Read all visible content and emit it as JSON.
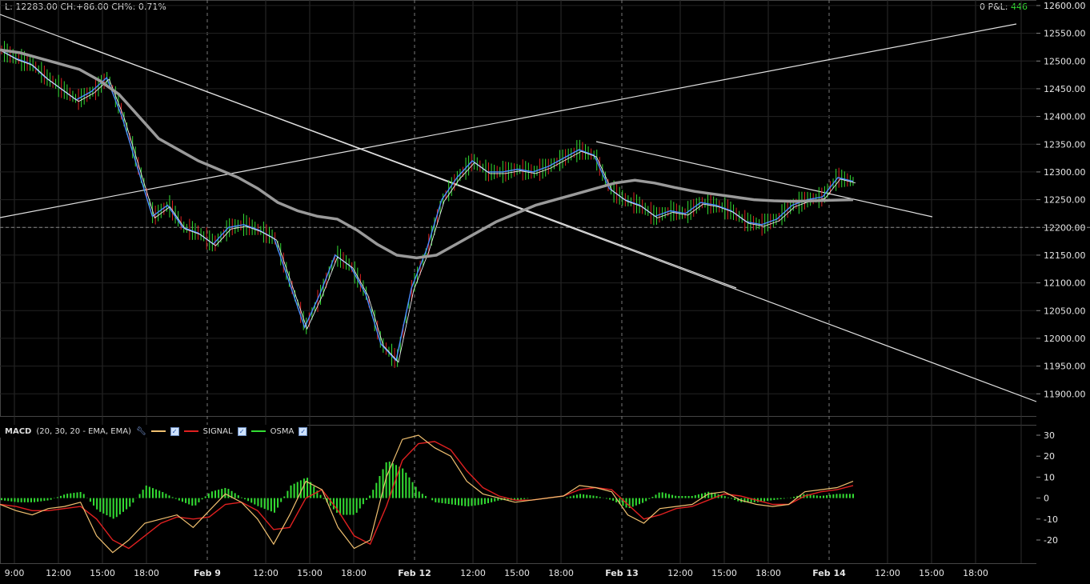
{
  "header": {
    "last_label": "L:",
    "last": "12283.00",
    "change_label": "CH:",
    "change": "+86.00",
    "change_pct_label": "CH%:",
    "change_pct": "0.71%",
    "pnl_value": "0",
    "pnl_label": "P&L:",
    "pnl_amount": "446"
  },
  "price_axis": {
    "ticks": [
      "12600.00",
      "12550.00",
      "12500.00",
      "12450.00",
      "12400.00",
      "12350.00",
      "12300.00",
      "12250.00",
      "12200.00",
      "12150.00",
      "12100.00",
      "12050.00",
      "12000.00",
      "11950.00",
      "11900.00"
    ]
  },
  "macd_legend": {
    "name": "MACD",
    "params": "(20, 30, 20 - EMA, EMA)",
    "signal_label": "SIGNAL",
    "osma_label": "OSMA",
    "colors": {
      "macd": "#f0c070",
      "signal": "#e02020",
      "osma": "#33dd33"
    }
  },
  "macd_axis": {
    "ticks": [
      "30",
      "20",
      "10",
      "0",
      "-10",
      "-20"
    ]
  },
  "time_axis": {
    "ticks": [
      "9:00",
      "12:00",
      "15:00",
      "18:00",
      "Feb 9",
      "12:00",
      "15:00",
      "18:00",
      "Feb 12",
      "12:00",
      "15:00",
      "18:00",
      "Feb 13",
      "12:00",
      "15:00",
      "18:00",
      "Feb 14",
      "12:00",
      "15:00",
      "18:00"
    ]
  },
  "chart_data": [
    {
      "type": "line",
      "title": "",
      "ylim": [
        11860,
        12610
      ],
      "x_range": [
        "Feb 8 09:00",
        "Feb 14 20:00"
      ],
      "grid": true,
      "reference_level": 12200,
      "series": [
        {
          "values": [
            12520,
            12505,
            12495,
            12470,
            12450,
            12430,
            12445,
            12470,
            12400,
            12310,
            12220,
            12240,
            12200,
            12190,
            12170,
            12200,
            12205,
            12195,
            12180,
            12100,
            12020,
            12080,
            12150,
            12130,
            12080,
            11990,
            11960,
            12090,
            12160,
            12250,
            12290,
            12320,
            12300,
            12300,
            12305,
            12300,
            12310,
            12325,
            12340,
            12330,
            12270,
            12250,
            12240,
            12220,
            12230,
            12225,
            12245,
            12240,
            12230,
            12210,
            12205,
            12215,
            12240,
            12250,
            12255,
            12290,
            12283
          ]
        },
        {
          "values": [
            12520,
            12515,
            12505,
            12495,
            12485,
            12465,
            12440,
            12400,
            12360,
            12340,
            12320,
            12305,
            12290,
            12270,
            12245,
            12230,
            12220,
            12215,
            12195,
            12170,
            12150,
            12145,
            12150,
            12170,
            12190,
            12210,
            12225,
            12240,
            12250,
            12260,
            12270,
            12280,
            12285,
            12280,
            12272,
            12265,
            12260,
            12255,
            12250,
            12248,
            12247,
            12248,
            12249,
            12250
          ]
        }
      ]
    },
    {
      "type": "line",
      "title": "",
      "ylim": [
        -28,
        33
      ],
      "series": [
        {
          "values": [
            -3,
            -6,
            -8,
            -5,
            -4,
            -2,
            -18,
            -26,
            -20,
            -12,
            -10,
            -8,
            -14,
            -6,
            2,
            -2,
            -10,
            -22,
            -8,
            8,
            4,
            -14,
            -24,
            -20,
            10,
            28,
            30,
            24,
            20,
            8,
            2,
            0,
            -2,
            -1,
            0,
            1,
            6,
            5,
            3,
            -8,
            -12,
            -5,
            -4,
            -3,
            2,
            3,
            -1,
            -3,
            -4,
            -3,
            3,
            4,
            5,
            8
          ]
        },
        {
          "values": [
            -3,
            -4,
            -6,
            -6,
            -5,
            -4,
            -10,
            -20,
            -24,
            -18,
            -12,
            -9,
            -10,
            -9,
            -3,
            -2,
            -6,
            -15,
            -14,
            0,
            4,
            -6,
            -18,
            -22,
            -4,
            18,
            26,
            27,
            23,
            13,
            5,
            1,
            -1,
            -1,
            0,
            1,
            4,
            5,
            4,
            -3,
            -10,
            -8,
            -5,
            -4,
            -1,
            2,
            1,
            -1,
            -3,
            -3,
            1,
            3,
            4,
            6
          ]
        },
        {
          "values": [
            -1,
            -2,
            -2,
            -1,
            2,
            3,
            -6,
            -10,
            -4,
            6,
            3,
            -1,
            -4,
            3,
            5,
            0,
            -4,
            -7,
            6,
            10,
            0,
            -8,
            -8,
            2,
            18,
            14,
            3,
            -2,
            -3,
            -4,
            -3,
            -1,
            -1,
            0,
            0,
            0,
            2,
            1,
            -1,
            -5,
            -2,
            3,
            1,
            1,
            3,
            1,
            -2,
            -2,
            -1,
            0,
            2,
            1,
            2,
            2
          ]
        }
      ]
    }
  ]
}
